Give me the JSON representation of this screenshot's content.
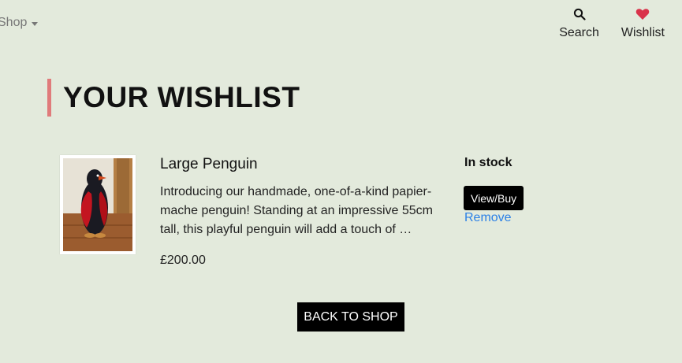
{
  "nav": {
    "shop_label": "Shop",
    "search_label": "Search",
    "wishlist_label": "Wishlist"
  },
  "page": {
    "title": "YOUR WISHLIST"
  },
  "wishlist_items": [
    {
      "name": "Large Penguin",
      "description": "Introducing our handmade, one-of-a-kind papier-mache penguin! Standing at an impressive 55cm tall, this playful penguin will add a touch of …",
      "price": "£200.00",
      "stock_status": "In stock",
      "view_buy_label": "View/Buy",
      "remove_label": "Remove",
      "image_icon": "penguin-image"
    }
  ],
  "actions": {
    "back_to_shop_label": "BACK TO SHOP"
  },
  "colors": {
    "background": "#e3eadc",
    "title_accent": "#e07b7b",
    "wishlist_heart": "#d9334a",
    "link": "#2b80e6",
    "button": "#000000"
  }
}
